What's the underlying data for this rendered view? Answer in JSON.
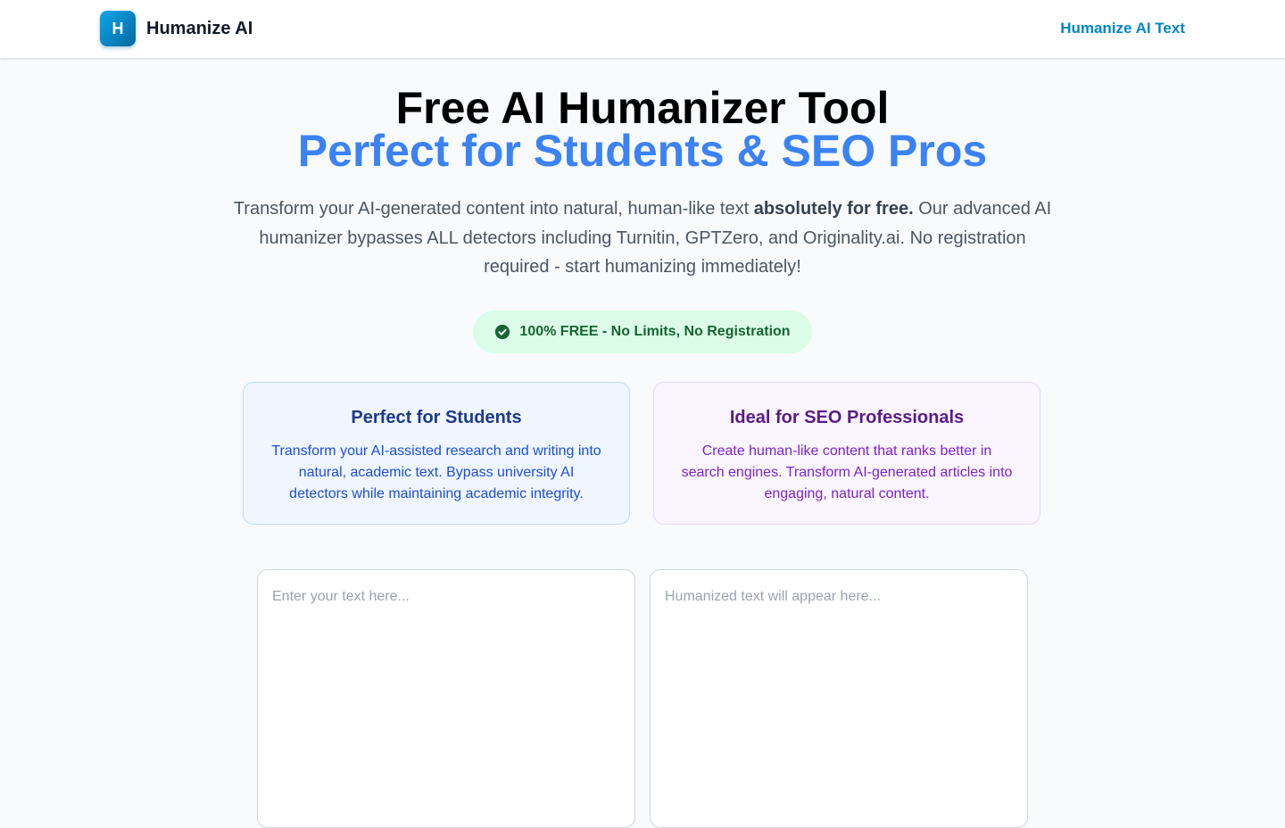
{
  "header": {
    "logo_letter": "H",
    "brand": "Humanize AI",
    "nav_link": "Humanize AI Text"
  },
  "hero": {
    "title": "Free AI Humanizer Tool",
    "subtitle": "Perfect for Students & SEO Pros",
    "description_part1": "Transform your AI-generated content into natural, human-like text ",
    "description_bold": "absolutely for free.",
    "description_part2": " Our advanced AI humanizer bypasses ALL detectors including Turnitin, GPTZero, and Originality.ai. No registration required - start humanizing immediately!"
  },
  "badge": {
    "icon": "check-circle-icon",
    "text": "100% FREE - No Limits, No Registration",
    "color": "#166534"
  },
  "cards": {
    "students": {
      "title": "Perfect for Students",
      "text": "Transform your AI-assisted research and writing into natural, academic text. Bypass university AI detectors while maintaining academic integrity."
    },
    "seo": {
      "title": "Ideal for SEO Professionals",
      "text": "Create human-like content that ranks better in search engines. Transform AI-generated articles into engaging, natural content."
    }
  },
  "editor": {
    "input_placeholder": "Enter your text here...",
    "input_value": "",
    "output_placeholder": "Humanized text will appear here...",
    "output_value": ""
  },
  "colors": {
    "accent": "#3b82f6",
    "brand": "#0284c7",
    "background": "#f8fafc"
  }
}
